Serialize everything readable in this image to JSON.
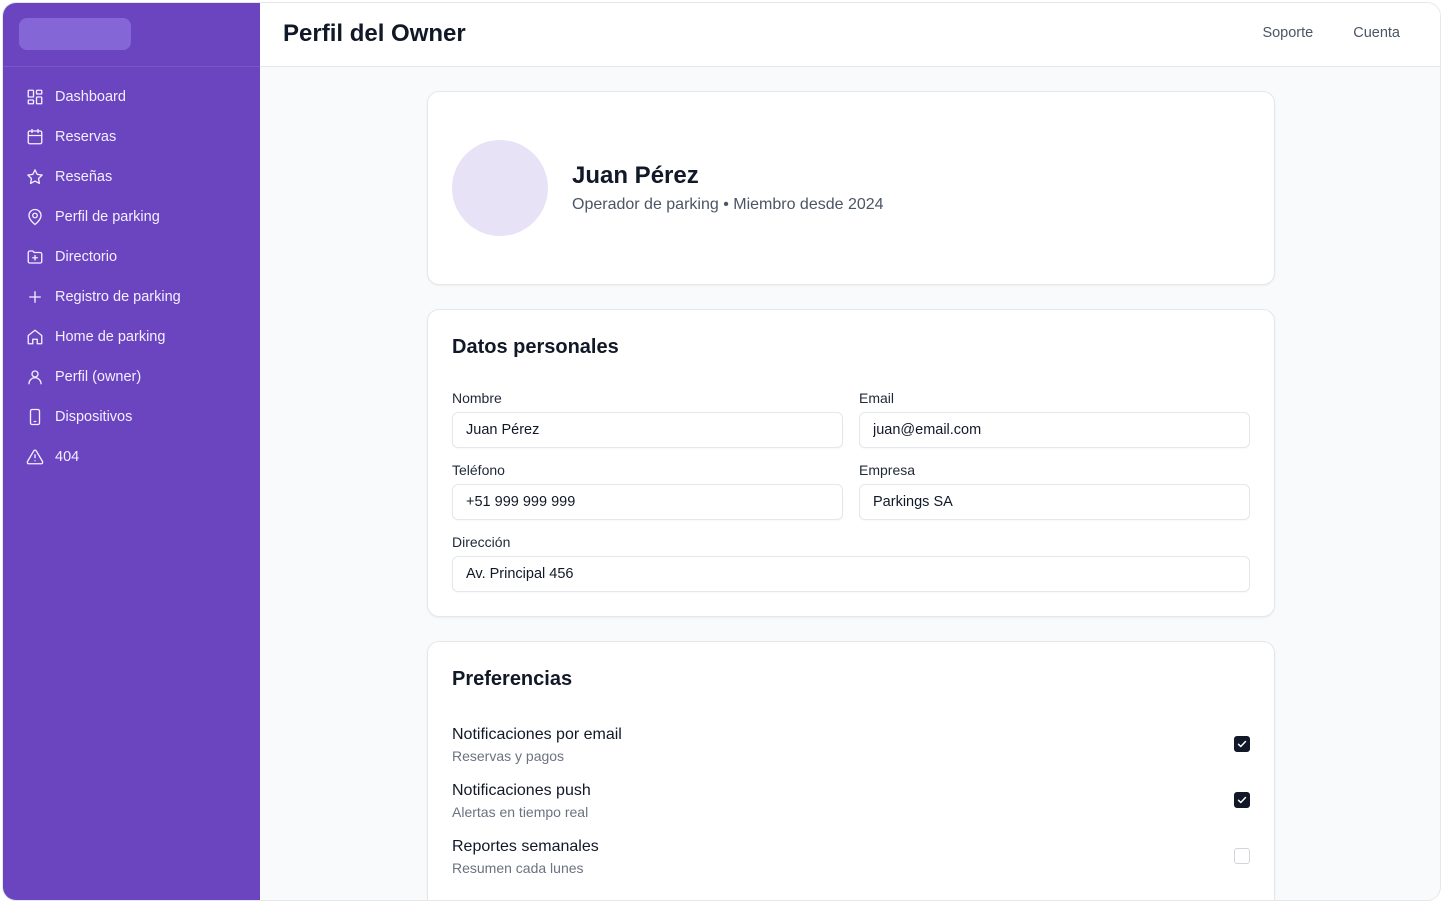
{
  "header": {
    "title": "Perfil del Owner",
    "links": [
      "Soporte",
      "Cuenta"
    ]
  },
  "sidebar": {
    "items": [
      {
        "label": "Dashboard",
        "icon": "dashboard-icon"
      },
      {
        "label": "Reservas",
        "icon": "calendar-icon"
      },
      {
        "label": "Reseñas",
        "icon": "star-icon"
      },
      {
        "label": "Perfil de parking",
        "icon": "map-pin-icon"
      },
      {
        "label": "Directorio",
        "icon": "folder-plus-icon"
      },
      {
        "label": "Registro de parking",
        "icon": "plus-icon"
      },
      {
        "label": "Home de parking",
        "icon": "home-icon"
      },
      {
        "label": "Perfil (owner)",
        "icon": "user-icon"
      },
      {
        "label": "Dispositivos",
        "icon": "smartphone-icon"
      },
      {
        "label": "404",
        "icon": "alert-triangle-icon"
      }
    ]
  },
  "profile": {
    "name": "Juan Pérez",
    "subtitle": "Operador de parking • Miembro desde 2024"
  },
  "personal": {
    "title": "Datos personales",
    "nombre": {
      "label": "Nombre",
      "value": "Juan Pérez"
    },
    "email": {
      "label": "Email",
      "value": "juan@email.com"
    },
    "telefono": {
      "label": "Teléfono",
      "value": "+51 999 999 999"
    },
    "empresa": {
      "label": "Empresa",
      "value": "Parkings SA"
    },
    "direccion": {
      "label": "Dirección",
      "value": "Av. Principal 456"
    }
  },
  "preferences": {
    "title": "Preferencias",
    "items": [
      {
        "title": "Notificaciones por email",
        "subtitle": "Reservas y pagos",
        "checked": true
      },
      {
        "title": "Notificaciones push",
        "subtitle": "Alertas en tiempo real",
        "checked": true
      },
      {
        "title": "Reportes semanales",
        "subtitle": "Resumen cada lunes",
        "checked": false
      }
    ]
  },
  "colors": {
    "sidebar_bg": "#6b45c0",
    "accent_light": "#e8e2f6",
    "checkbox_checked": "#111827"
  }
}
